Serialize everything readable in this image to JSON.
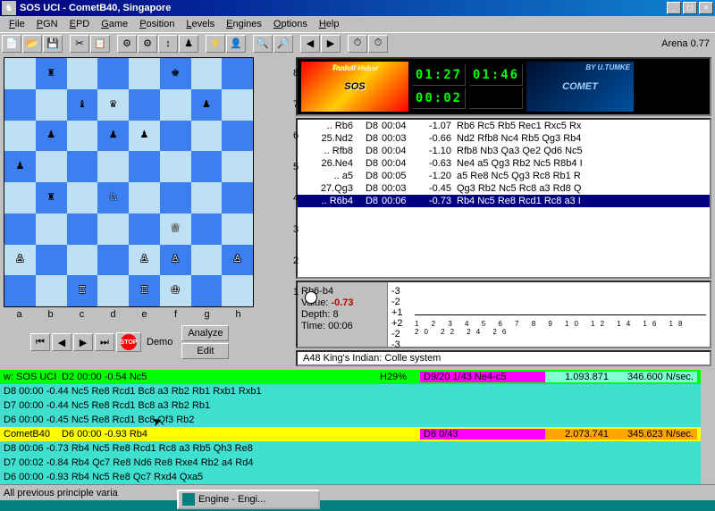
{
  "title": "SOS UCI - CometB40, Singapore",
  "menus": [
    "File",
    "PGN",
    "EPD",
    "Game",
    "Position",
    "Levels",
    "Engines",
    "Options",
    "Help"
  ],
  "version": "Arena 0.77",
  "board": {
    "files": [
      "a",
      "b",
      "c",
      "d",
      "e",
      "f",
      "g",
      "h"
    ],
    "ranks": [
      "8",
      "7",
      "6",
      "5",
      "4",
      "3",
      "2",
      "1"
    ],
    "position": [
      [
        " ",
        "r",
        " ",
        " ",
        " ",
        "k",
        " ",
        " "
      ],
      [
        " ",
        " ",
        "b",
        "q",
        " ",
        " ",
        "p",
        " "
      ],
      [
        " ",
        "p",
        " ",
        "p",
        "p",
        " ",
        " ",
        " "
      ],
      [
        "p",
        " ",
        " ",
        " ",
        " ",
        " ",
        " ",
        " "
      ],
      [
        " ",
        "r",
        " ",
        "N",
        " ",
        " ",
        " ",
        " "
      ],
      [
        " ",
        " ",
        " ",
        " ",
        " ",
        "Q",
        " ",
        " "
      ],
      [
        "P",
        " ",
        " ",
        " ",
        "P",
        "P",
        " ",
        "P"
      ],
      [
        " ",
        " ",
        "R",
        " ",
        "R",
        "K",
        " ",
        " "
      ]
    ]
  },
  "controls": {
    "demo": "Demo",
    "analyze": "Analyze",
    "edit": "Edit",
    "stop": "STOP"
  },
  "engines": {
    "left": {
      "author": "Rudolf Huber",
      "name": "SOS"
    },
    "right": {
      "author": "BY U.TUMKE",
      "name": "COMET"
    },
    "clocks": {
      "leftMain": "01:27",
      "leftSub": "00:02",
      "rightMain": "01:46",
      "rightSub": ""
    }
  },
  "moves": [
    {
      "mv": ".. Rb6",
      "d": "D8",
      "t": "00:04",
      "e": "-1.07",
      "pv": "Rb6 Rc5 Rb5 Rec1 Rxc5 Rx"
    },
    {
      "mv": "25.Nd2",
      "d": "D8",
      "t": "00:03",
      "e": "-0.66",
      "pv": "Nd2 Rfb8 Nc4 Rb5 Qg3 Rb4"
    },
    {
      "mv": ".. Rfb8",
      "d": "D8",
      "t": "00:04",
      "e": "-1.10",
      "pv": "Rfb8 Nb3 Qa3 Qe2 Qd6 Nc5"
    },
    {
      "mv": "26.Ne4",
      "d": "D8",
      "t": "00:04",
      "e": "-0.63",
      "pv": "Ne4 a5 Qg3 Rb2 Nc5 R8b4 I"
    },
    {
      "mv": ".. a5",
      "d": "D8",
      "t": "00:05",
      "e": "-1.20",
      "pv": "a5 Re8 Nc5 Qg3 Rc8 Rb1 R"
    },
    {
      "mv": "27.Qg3",
      "d": "D8",
      "t": "00:03",
      "e": "-0.45",
      "pv": "Qg3 Rb2 Nc5 Rc8 a3 Rd8 Q"
    },
    {
      "mv": ".. R6b4",
      "d": "D8",
      "t": "00:06",
      "e": "-0.73",
      "pv": "Rb4 Nc5 Re8 Rcd1 Rc8 a3 I",
      "sel": true
    }
  ],
  "eval": {
    "move": "Rb6-b4",
    "valueLabel": "Value:",
    "value": "-0.73",
    "depthLabel": "Depth:",
    "depth": "8",
    "timeLabel": "Time:",
    "time": "00:06"
  },
  "opening": "A48  King's Indian: Colle system",
  "analysis": {
    "eng1": {
      "name": "w: SOS UCI",
      "header": "D2  00:00 -0.54  Nc5",
      "hash": "H29%",
      "status": "D9/20  1/43 Ne4-c5",
      "nodes": "1.093.871",
      "nps": "346.600 N/sec.",
      "lines": [
        "D8  00:00 -0.44   Nc5 Re8 Rcd1 Bc8 a3 Rb2 Rb1 Rxb1 Rxb1",
        "D7  00:00 -0.44   Nc5 Re8 Rcd1 Bc8 a3 Rb2 Rb1",
        "D6  00:00 -0.45   Nc5 Re8 Rcd1 Bc8 Qf3 Rb2"
      ]
    },
    "eng2": {
      "name": "CometB40",
      "header": "D6  00:00 -0.93  Rb4",
      "status": "D8  0/43",
      "nodes": "2.073.741",
      "nps": "345.623 N/sec.",
      "lines": [
        "D8  00:06 -0.73   Rb4 Nc5 Re8 Rcd1 Rc8 a3 Rb5 Qh3 Re8",
        "D7  00:02 -0.84   Rb4 Qc7 Re8 Nd6 Re8 Rxe4 Rb2 a4 Rd4",
        "D6  00:00 -0.93   Rb4 Nc5 Re8 Qc7 Rxd4 Qxa5"
      ]
    }
  },
  "statusbar": "All previous principle varia",
  "taskbar": "Engine - Engi..."
}
